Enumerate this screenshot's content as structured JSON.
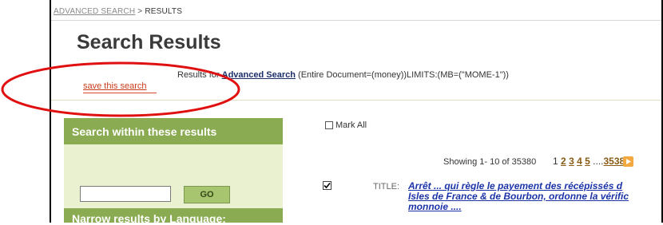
{
  "breadcrumb": {
    "link": "ADVANCED SEARCH",
    "separator": ">",
    "current": "RESULTS"
  },
  "page_title": "Search Results",
  "results_for": {
    "prefix": "Results for",
    "link": "Advanced Search",
    "query": "(Entire Document=(money))LIMITS:(MB=(\"MOME-1\"))"
  },
  "save_search_label": "save this search",
  "left_panel": {
    "header": "Search within these results",
    "search_input_value": "",
    "go_label": "GO",
    "narrow_header": "Narrow results by Language:"
  },
  "mark_all_label": "Mark All",
  "showing": "Showing 1- 10 of 35380",
  "pagination": {
    "current": "1",
    "pages": [
      "2",
      "3",
      "4",
      "5"
    ],
    "ellipsis": "....",
    "last": "3538"
  },
  "result": {
    "checked": true,
    "label": "TITLE:",
    "title": "Arrêt ... qui règle le payement des récépissés d\nIsles de France & de Bourbon, ordonne la vérific\nmonnoie ...."
  },
  "colors": {
    "accent_green": "#8aab52",
    "panel_bg": "#eaf1d0",
    "link_blue": "#1a33a8",
    "save_red": "#cc3a1a",
    "annotation_red": "#e01010"
  },
  "icons": {
    "next": "next-page-icon",
    "check": "checkmark-icon"
  }
}
